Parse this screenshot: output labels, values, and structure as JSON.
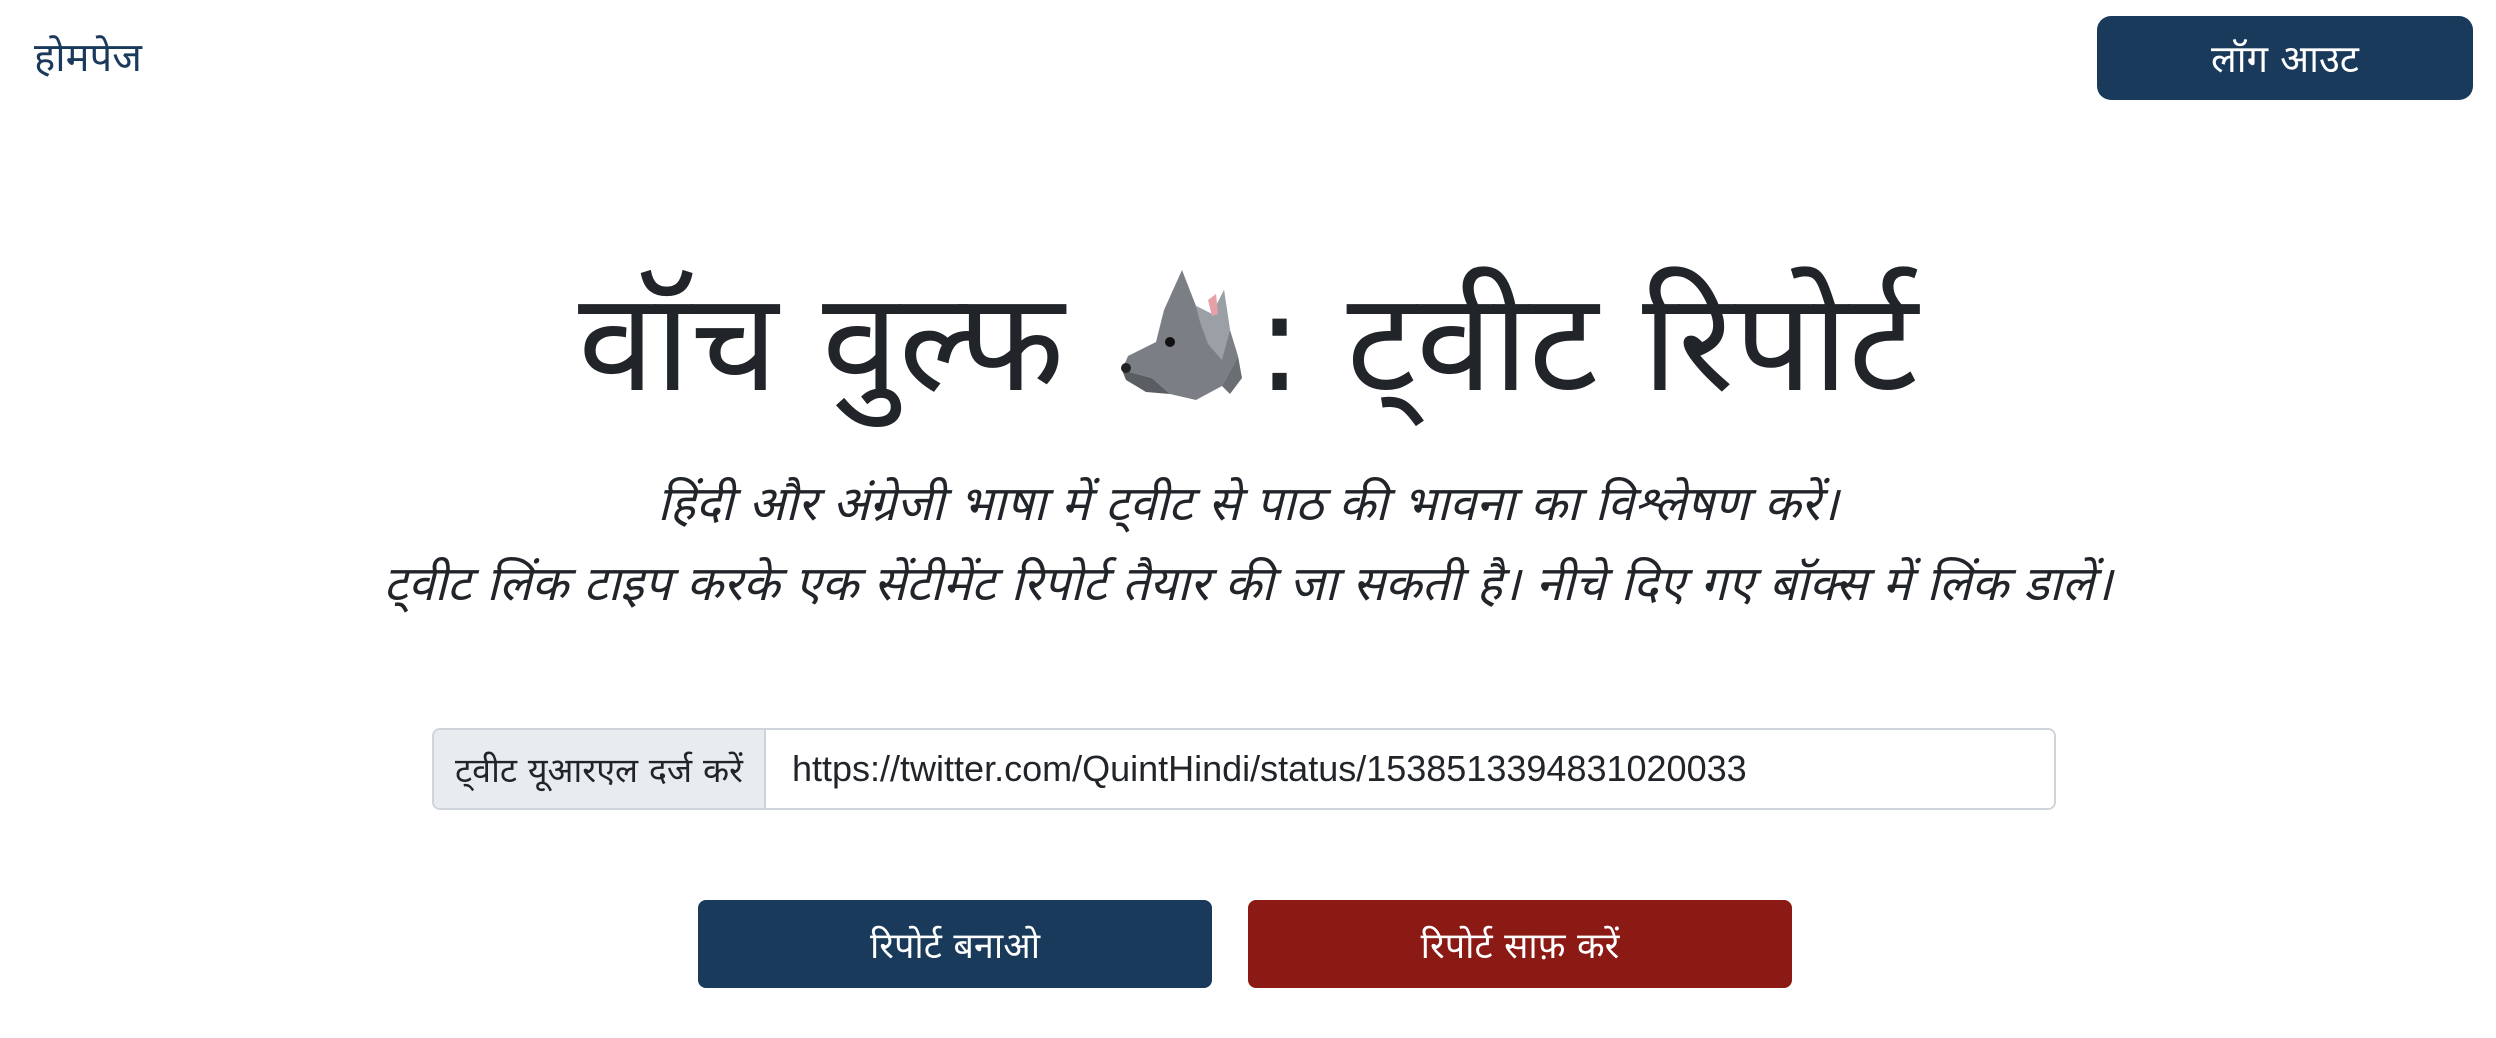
{
  "nav": {
    "home_label": "होमपेज",
    "logout_label": "लॉग आउट"
  },
  "hero": {
    "title_part1": "वॉच वुल्फ",
    "title_part2": ": ट्वीट रिपोर्ट",
    "title_icon": "wolf-icon",
    "subtitle_line1": "हिंदी और अंग्रेजी भाषा में ट्वीट से पाठ की भावना का विश्लेषण करें।",
    "subtitle_line2": "ट्वीट लिंक टाइप करके एक सेंटीमेंट रिपोर्ट तैयार की जा सकती है। नीचे दिए गए बॉक्स में लिंक डालें।"
  },
  "form": {
    "url_label": "ट्वीट यूआरएल दर्ज करें",
    "url_value": "https://twitter.com/QuintHindi/status/1538513394831020033"
  },
  "actions": {
    "generate_label": "रिपोर्ट बनाओ",
    "clear_label": "रिपोर्ट साफ़ करें"
  },
  "colors": {
    "primary": "#1a3a5c",
    "danger": "#8b1a14",
    "text": "#212529",
    "addon_bg": "#e9ecef",
    "border": "#ced4da"
  }
}
